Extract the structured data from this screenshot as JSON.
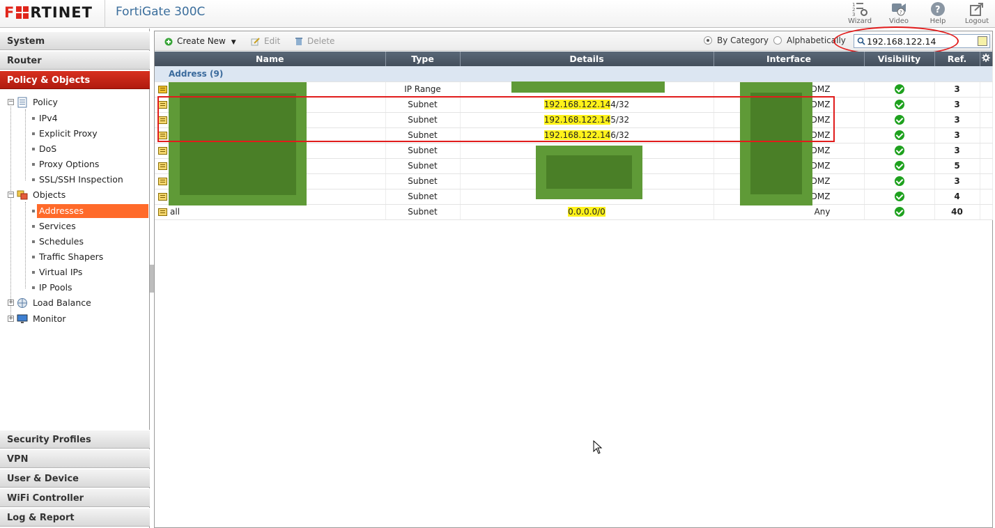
{
  "header": {
    "brand": "F RTINET",
    "model": "FortiGate 300C",
    "buttons": [
      {
        "label": "Wizard",
        "icon": "wizard-icon"
      },
      {
        "label": "Video",
        "icon": "video-icon"
      },
      {
        "label": "Help",
        "icon": "help-icon"
      },
      {
        "label": "Logout",
        "icon": "logout-icon"
      }
    ]
  },
  "sidebar": {
    "top_sections": [
      "System",
      "Router",
      "Policy & Objects"
    ],
    "bottom_sections": [
      "Security Profiles",
      "VPN",
      "User & Device",
      "WiFi Controller",
      "Log & Report"
    ],
    "tree": {
      "policy": "Policy",
      "policy_items": [
        "IPv4",
        "Explicit Proxy",
        "DoS",
        "Proxy Options",
        "SSL/SSH Inspection"
      ],
      "objects": "Objects",
      "objects_items": [
        "Addresses",
        "Services",
        "Schedules",
        "Traffic Shapers",
        "Virtual IPs",
        "IP Pools"
      ],
      "load_balance": "Load Balance",
      "monitor": "Monitor"
    }
  },
  "toolbar": {
    "create_new": "Create New",
    "edit": "Edit",
    "delete": "Delete",
    "by_category": "By Category",
    "alphabetically": "Alphabetically",
    "search_value": "192.168.122.14"
  },
  "table": {
    "columns": [
      "Name",
      "Type",
      "Details",
      "Interface",
      "Visibility",
      "Ref."
    ],
    "category": "Address (9)",
    "rows": [
      {
        "name": "",
        "type": "IP Range",
        "details_hl": "",
        "details_rest": "",
        "interface": "DMZ",
        "ref": "3"
      },
      {
        "name": "",
        "type": "Subnet",
        "details_hl": "192.168.122.14",
        "details_rest": "4/32",
        "interface": "DMZ",
        "ref": "3"
      },
      {
        "name": "",
        "type": "Subnet",
        "details_hl": "192.168.122.14",
        "details_rest": "5/32",
        "interface": "DMZ",
        "ref": "3"
      },
      {
        "name": "",
        "type": "Subnet",
        "details_hl": "192.168.122.14",
        "details_rest": "6/32",
        "interface": "DMZ",
        "ref": "3"
      },
      {
        "name": "",
        "type": "Subnet",
        "details_hl": "",
        "details_rest": "",
        "interface": "DMZ",
        "ref": "3"
      },
      {
        "name": "",
        "type": "Subnet",
        "details_hl": "",
        "details_rest": "",
        "interface": "DMZ",
        "ref": "5"
      },
      {
        "name": "",
        "type": "Subnet",
        "details_hl": "",
        "details_rest": "",
        "interface": "DMZ",
        "ref": "3"
      },
      {
        "name": "",
        "type": "Subnet",
        "details_hl": "",
        "details_rest": "",
        "interface": "DMZ",
        "ref": "4"
      },
      {
        "name": "all",
        "type": "Subnet",
        "details_hl": "0.0.0.0/0",
        "details_rest": "",
        "interface": "Any",
        "ref": "40"
      }
    ]
  },
  "colors": {
    "brand_red": "#e0261b",
    "active_nav": "#c4271a",
    "selected_tree": "#ff6a2a",
    "highlight": "#fff21a",
    "visibility_ok": "#1ea11e",
    "redaction": "#5f9a37",
    "annotation": "#e11b1b"
  }
}
